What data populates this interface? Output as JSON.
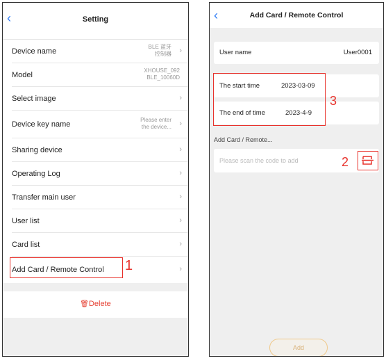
{
  "left": {
    "title": "Setting",
    "rows": [
      {
        "label": "Device name",
        "value": [
          "BLE 蓝牙",
          "控制器"
        ]
      },
      {
        "label": "Model",
        "value": [
          "XHOUSE_092",
          "BLE_10060D"
        ]
      },
      {
        "label": "Select image",
        "value": []
      },
      {
        "label": "Device key name",
        "value": [
          "Please enter",
          "the device..."
        ]
      },
      {
        "label": "Sharing device",
        "value": []
      },
      {
        "label": "Operating Log",
        "value": []
      },
      {
        "label": "Transfer main user",
        "value": []
      },
      {
        "label": "User list",
        "value": []
      },
      {
        "label": "Card list",
        "value": []
      },
      {
        "label": "Add Card / Remote Control",
        "value": []
      }
    ],
    "delete_label": "Delete",
    "annotation": "1"
  },
  "right": {
    "title": "Add Card / Remote Control",
    "user_name_label": "User name",
    "user_name_value": "User0001",
    "start_label": "The start time",
    "start_value": "2023-03-09",
    "end_label": "The end of time",
    "end_value": "2023-4-9",
    "section_label": "Add Card / Remote...",
    "scan_placeholder": "Please scan the code to add",
    "add_button": "Add",
    "annotation_2": "2",
    "annotation_3": "3"
  },
  "colors": {
    "accent": "#2d7bf6",
    "danger": "#e53e30",
    "annotation": "#e8322c",
    "button_border": "#f0c98a"
  }
}
